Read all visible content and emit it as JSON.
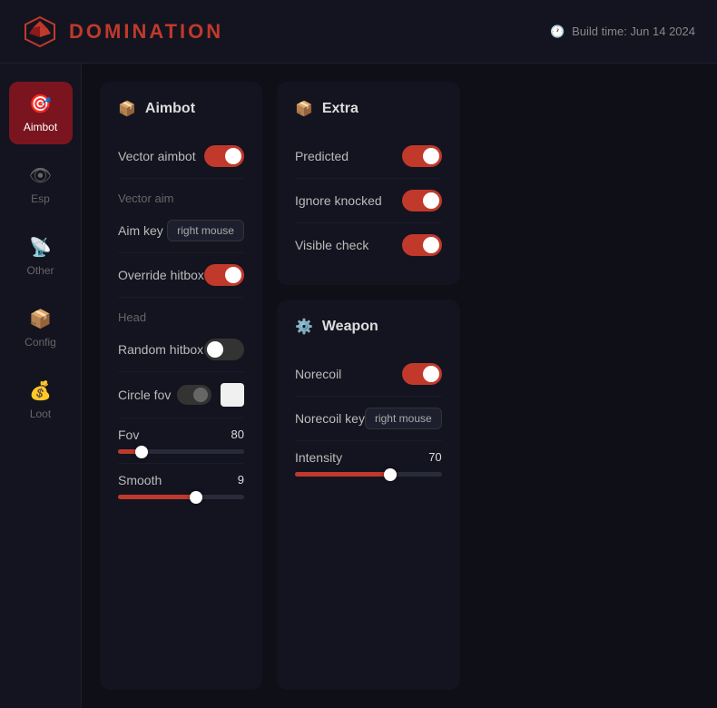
{
  "header": {
    "logo_text": "DOMINATION",
    "build_label": "Build time: Jun 14 2024"
  },
  "sidebar": {
    "items": [
      {
        "id": "aimbot",
        "label": "Aimbot",
        "icon": "🎯",
        "active": true
      },
      {
        "id": "esp",
        "label": "Esp",
        "icon": "👁",
        "active": false
      },
      {
        "id": "other",
        "label": "Other",
        "icon": "📡",
        "active": false
      },
      {
        "id": "config",
        "label": "Config",
        "icon": "📦",
        "active": false
      },
      {
        "id": "loot",
        "label": "Loot",
        "icon": "💰",
        "active": false
      }
    ]
  },
  "aimbot_panel": {
    "title": "Aimbot",
    "vector_aimbot_label": "Vector aimbot",
    "vector_aimbot_on": true,
    "section_vector_aim": "Vector aim",
    "aim_key_label": "Aim key",
    "aim_key_value": "right mouse",
    "override_hitbox_label": "Override hitbox",
    "override_hitbox_on": true,
    "section_head": "Head",
    "random_hitbox_label": "Random hitbox",
    "random_hitbox_on": false,
    "circle_fov_label": "Circle fov",
    "circle_fov_on": false,
    "fov_label": "Fov",
    "fov_value": "80",
    "fov_percent": 19,
    "smooth_label": "Smooth",
    "smooth_value": "9",
    "smooth_percent": 62
  },
  "extra_panel": {
    "title": "Extra",
    "predicted_label": "Predicted",
    "predicted_on": true,
    "ignore_knocked_label": "Ignore knocked",
    "ignore_knocked_on": true,
    "visible_check_label": "Visible check",
    "visible_check_on": true
  },
  "weapon_panel": {
    "title": "Weapon",
    "norecoil_label": "Norecoil",
    "norecoil_on": true,
    "norecoil_key_label": "Norecoil key",
    "norecoil_key_value": "right mouse",
    "intensity_label": "Intensity",
    "intensity_value": "70",
    "intensity_percent": 65
  }
}
